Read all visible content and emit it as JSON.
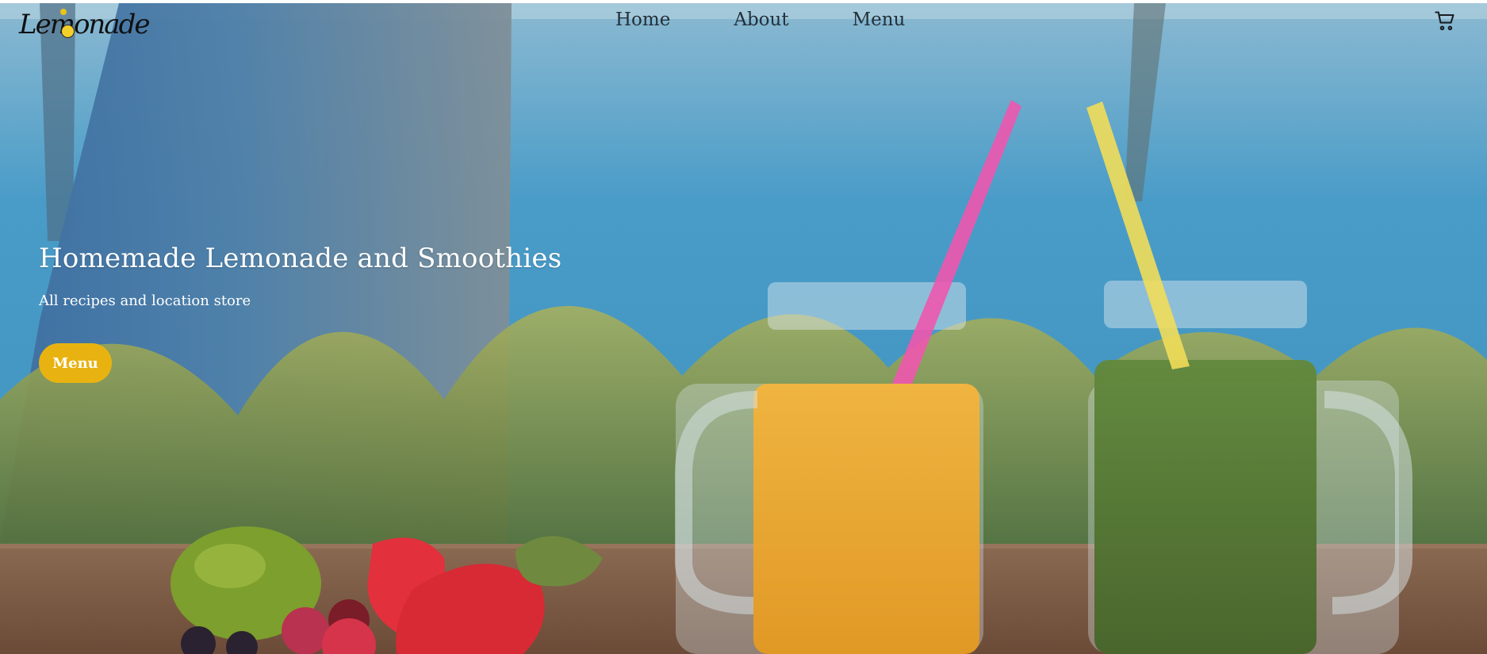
{
  "brand": {
    "logo_text": "Lemonade"
  },
  "nav": {
    "links": [
      {
        "label": "Home"
      },
      {
        "label": "About"
      },
      {
        "label": "Menu"
      }
    ]
  },
  "hero": {
    "title": "Homemade Lemonade and Smoothies",
    "subtitle": "All recipes and location store",
    "cta_label": "Menu"
  },
  "icons": {
    "cart": "cart-icon"
  },
  "colors": {
    "accent": "#e8b311",
    "hero_text": "#ffffff",
    "nav_text": "#23303a"
  }
}
